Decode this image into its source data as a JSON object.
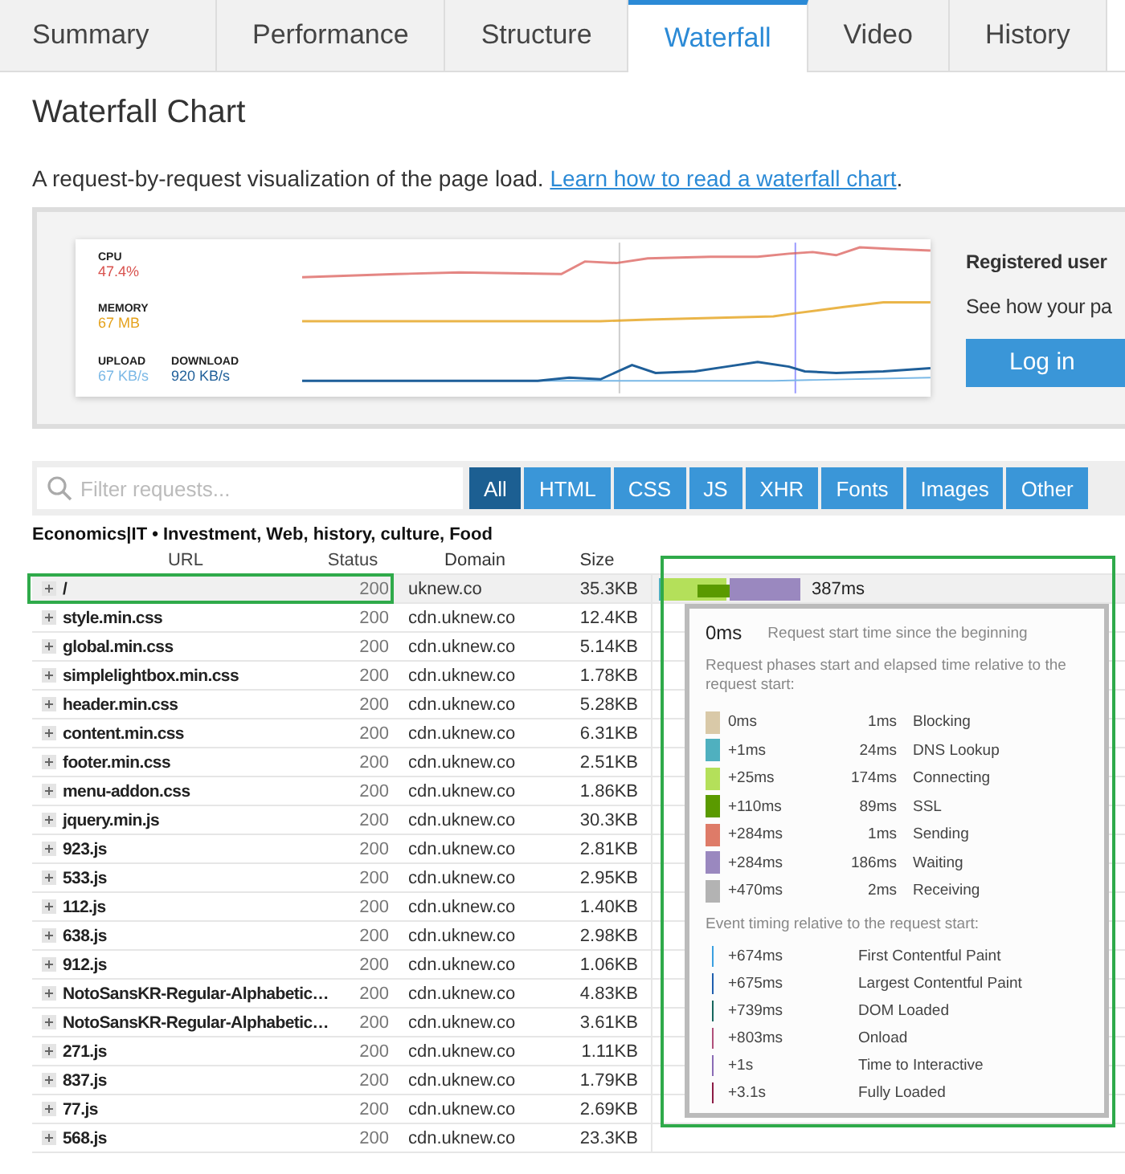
{
  "tabs": [
    {
      "label": "Summary",
      "selected": false
    },
    {
      "label": "Performance",
      "selected": false
    },
    {
      "label": "Structure",
      "selected": false
    },
    {
      "label": "Waterfall",
      "selected": true
    },
    {
      "label": "Video",
      "selected": false
    },
    {
      "label": "History",
      "selected": false
    }
  ],
  "title": "Waterfall Chart",
  "description": {
    "text": "A request-by-request visualization of the page load.",
    "link": "Learn how to read a waterfall chart",
    "end": "."
  },
  "banner": {
    "metrics": [
      {
        "label": "CPU",
        "value": "47.4%",
        "color": "#d9534f"
      },
      {
        "label": "MEMORY",
        "value": "67 MB",
        "color": "#e5a21c"
      },
      {
        "label": "UPLOAD",
        "value": "67 KB/s",
        "color": "#7ab8e6"
      },
      {
        "label": "DOWNLOAD",
        "value": "920 KB/s",
        "color": "#1f5f99"
      }
    ],
    "heading": "Registered user",
    "text": "See how your pa",
    "button": "Log in"
  },
  "filter": {
    "placeholder": "Filter requests...",
    "buttons": [
      {
        "label": "All",
        "selected": true
      },
      {
        "label": "HTML",
        "selected": false
      },
      {
        "label": "CSS",
        "selected": false
      },
      {
        "label": "JS",
        "selected": false
      },
      {
        "label": "XHR",
        "selected": false
      },
      {
        "label": "Fonts",
        "selected": false
      },
      {
        "label": "Images",
        "selected": false
      },
      {
        "label": "Other",
        "selected": false
      }
    ]
  },
  "page_title": "Economics|IT • Investment, Web, history, culture, Food",
  "table": {
    "columns": [
      "URL",
      "Status",
      "Domain",
      "Size"
    ],
    "rows": [
      {
        "url": "/",
        "status": "200",
        "domain": "uknew.co",
        "size": "35.3KB",
        "selected": true,
        "time": "387ms"
      },
      {
        "url": "style.min.css",
        "status": "200",
        "domain": "cdn.uknew.co",
        "size": "12.4KB",
        "selected": false
      },
      {
        "url": "global.min.css",
        "status": "200",
        "domain": "cdn.uknew.co",
        "size": "5.14KB",
        "selected": false
      },
      {
        "url": "simplelightbox.min.css",
        "status": "200",
        "domain": "cdn.uknew.co",
        "size": "1.78KB",
        "selected": false
      },
      {
        "url": "header.min.css",
        "status": "200",
        "domain": "cdn.uknew.co",
        "size": "5.28KB",
        "selected": false
      },
      {
        "url": "content.min.css",
        "status": "200",
        "domain": "cdn.uknew.co",
        "size": "6.31KB",
        "selected": false
      },
      {
        "url": "footer.min.css",
        "status": "200",
        "domain": "cdn.uknew.co",
        "size": "2.51KB",
        "selected": false
      },
      {
        "url": "menu-addon.css",
        "status": "200",
        "domain": "cdn.uknew.co",
        "size": "1.86KB",
        "selected": false
      },
      {
        "url": "jquery.min.js",
        "status": "200",
        "domain": "cdn.uknew.co",
        "size": "30.3KB",
        "selected": false
      },
      {
        "url": "923.js",
        "status": "200",
        "domain": "cdn.uknew.co",
        "size": "2.81KB",
        "selected": false
      },
      {
        "url": "533.js",
        "status": "200",
        "domain": "cdn.uknew.co",
        "size": "2.95KB",
        "selected": false
      },
      {
        "url": "112.js",
        "status": "200",
        "domain": "cdn.uknew.co",
        "size": "1.40KB",
        "selected": false
      },
      {
        "url": "638.js",
        "status": "200",
        "domain": "cdn.uknew.co",
        "size": "2.98KB",
        "selected": false
      },
      {
        "url": "912.js",
        "status": "200",
        "domain": "cdn.uknew.co",
        "size": "1.06KB",
        "selected": false
      },
      {
        "url": "NotoSansKR-Regular-Alphabetic…",
        "status": "200",
        "domain": "cdn.uknew.co",
        "size": "4.83KB",
        "selected": false
      },
      {
        "url": "NotoSansKR-Regular-Alphabetic…",
        "status": "200",
        "domain": "cdn.uknew.co",
        "size": "3.61KB",
        "selected": false
      },
      {
        "url": "271.js",
        "status": "200",
        "domain": "cdn.uknew.co",
        "size": "1.11KB",
        "selected": false
      },
      {
        "url": "837.js",
        "status": "200",
        "domain": "cdn.uknew.co",
        "size": "1.79KB",
        "selected": false
      },
      {
        "url": "77.js",
        "status": "200",
        "domain": "cdn.uknew.co",
        "size": "2.69KB",
        "selected": false
      },
      {
        "url": "568.js",
        "status": "200",
        "domain": "cdn.uknew.co",
        "size": "23.3KB",
        "selected": false
      }
    ]
  },
  "tooltip": {
    "start": "0ms",
    "start_label": "Request start time since the beginning",
    "phases_intro": "Request phases start and elapsed time relative to the request start:",
    "phases": [
      {
        "start": "0ms",
        "duration": "1ms",
        "name": "Blocking",
        "color": "#d9c9a8"
      },
      {
        "start": "+1ms",
        "duration": "24ms",
        "name": "DNS Lookup",
        "color": "#4fb0bf"
      },
      {
        "start": "+25ms",
        "duration": "174ms",
        "name": "Connecting",
        "color": "#b4e05a"
      },
      {
        "start": "+110ms",
        "duration": "89ms",
        "name": "SSL",
        "color": "#5a9a00"
      },
      {
        "start": "+284ms",
        "duration": "1ms",
        "name": "Sending",
        "color": "#de7b68"
      },
      {
        "start": "+284ms",
        "duration": "186ms",
        "name": "Waiting",
        "color": "#9a88bf"
      },
      {
        "start": "+470ms",
        "duration": "2ms",
        "name": "Receiving",
        "color": "#b3b3b3"
      }
    ],
    "events_intro": "Event timing relative to the request start:",
    "events": [
      {
        "time": "+674ms",
        "name": "First Contentful Paint",
        "color": "#3aa0e0"
      },
      {
        "time": "+675ms",
        "name": "Largest Contentful Paint",
        "color": "#1f5fae"
      },
      {
        "time": "+739ms",
        "name": "DOM Loaded",
        "color": "#17665e"
      },
      {
        "time": "+803ms",
        "name": "Onload",
        "color": "#b0507a"
      },
      {
        "time": "+1s",
        "name": "Time to Interactive",
        "color": "#8a6bb5"
      },
      {
        "time": "+3.1s",
        "name": "Fully Loaded",
        "color": "#8c1b45"
      }
    ]
  }
}
